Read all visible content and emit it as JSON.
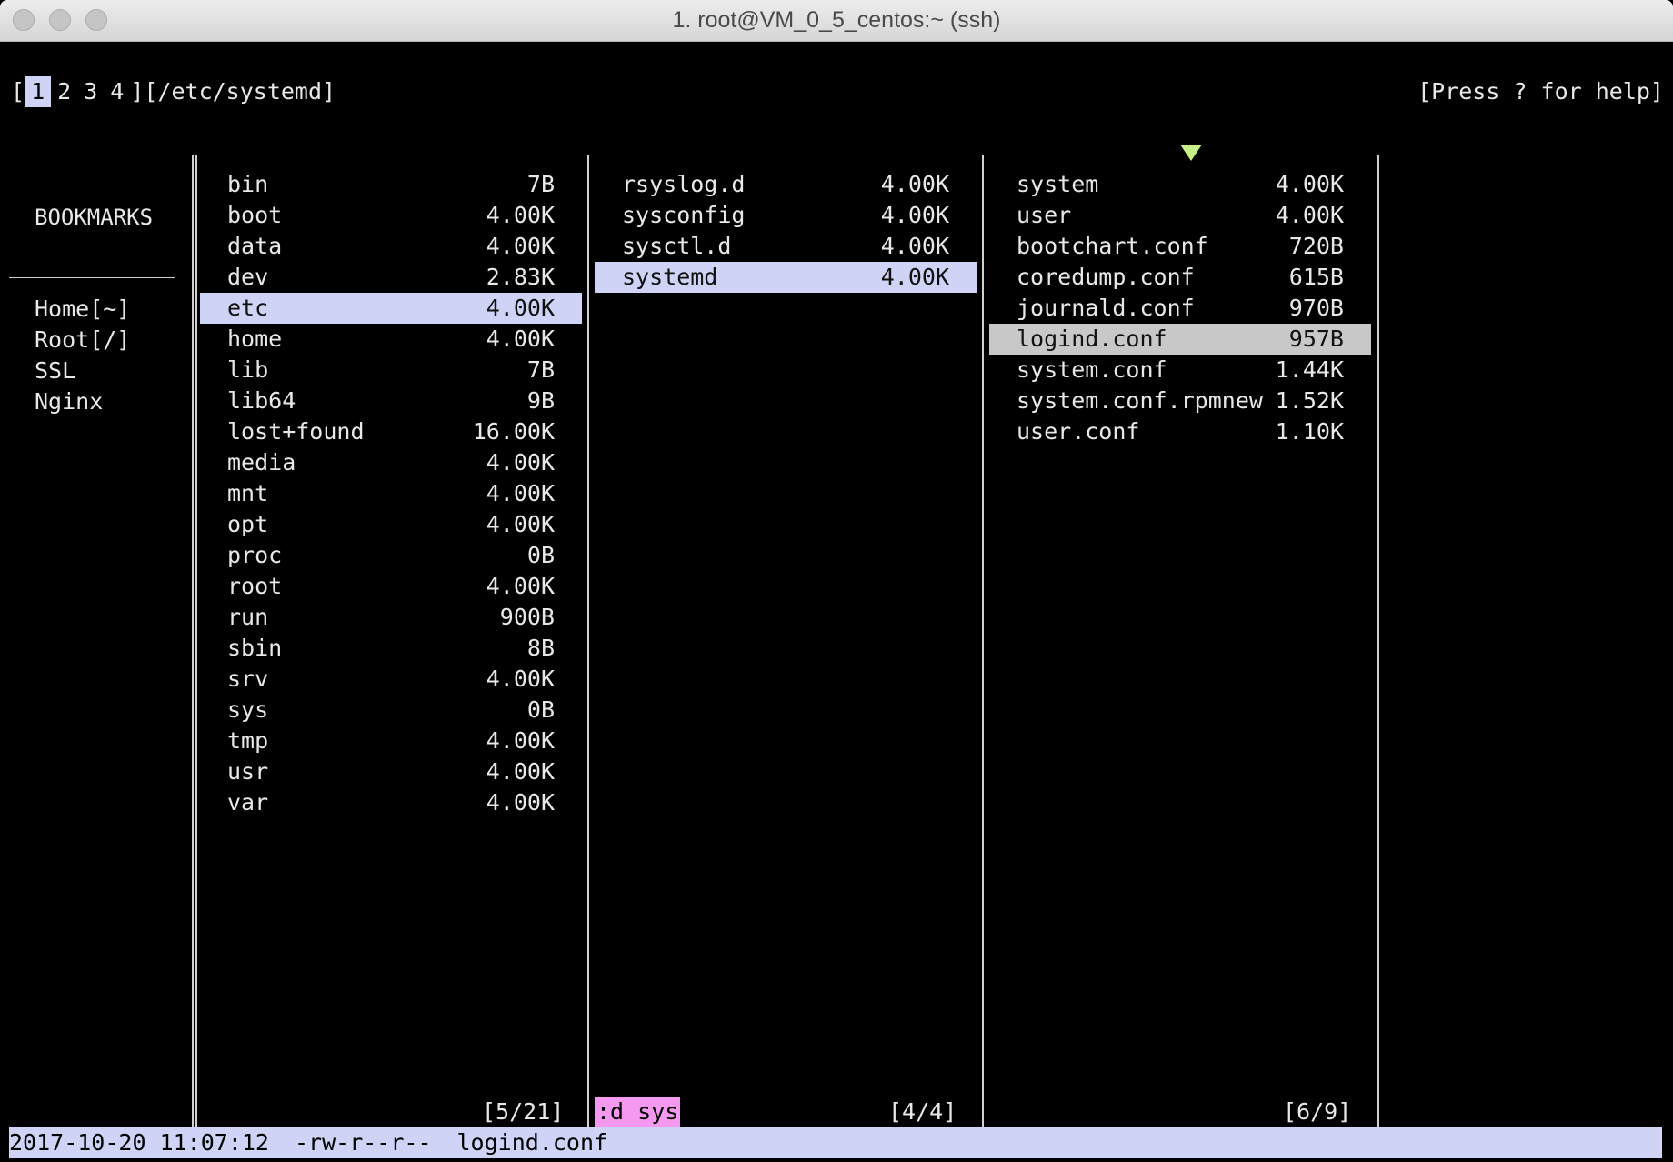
{
  "window": {
    "title": "1. root@VM_0_5_centos:~ (ssh)"
  },
  "header": {
    "bracket_open": "[",
    "tabs": [
      "1",
      "2",
      "3",
      "4"
    ],
    "path": "][/etc/systemd]",
    "help": "[Press ? for help]"
  },
  "bookmarks": {
    "title": "BOOKMARKS",
    "items": [
      "Home[~]",
      "Root[/]",
      "SSL",
      "Nginx"
    ]
  },
  "columns": {
    "root": {
      "rows": [
        {
          "name": "bin",
          "size": "7B"
        },
        {
          "name": "boot",
          "size": "4.00K"
        },
        {
          "name": "data",
          "size": "4.00K"
        },
        {
          "name": "dev",
          "size": "2.83K"
        },
        {
          "name": "etc",
          "size": "4.00K"
        },
        {
          "name": "home",
          "size": "4.00K"
        },
        {
          "name": "lib",
          "size": "7B"
        },
        {
          "name": "lib64",
          "size": "9B"
        },
        {
          "name": "lost+found",
          "size": "16.00K"
        },
        {
          "name": "media",
          "size": "4.00K"
        },
        {
          "name": "mnt",
          "size": "4.00K"
        },
        {
          "name": "opt",
          "size": "4.00K"
        },
        {
          "name": "proc",
          "size": "0B"
        },
        {
          "name": "root",
          "size": "4.00K"
        },
        {
          "name": "run",
          "size": "900B"
        },
        {
          "name": "sbin",
          "size": "8B"
        },
        {
          "name": "srv",
          "size": "4.00K"
        },
        {
          "name": "sys",
          "size": "0B"
        },
        {
          "name": "tmp",
          "size": "4.00K"
        },
        {
          "name": "usr",
          "size": "4.00K"
        },
        {
          "name": "var",
          "size": "4.00K"
        }
      ],
      "selected": 4,
      "counter": "[5/21]"
    },
    "etc": {
      "rows": [
        {
          "name": "rsyslog.d",
          "size": "4.00K"
        },
        {
          "name": "sysconfig",
          "size": "4.00K"
        },
        {
          "name": "sysctl.d",
          "size": "4.00K"
        },
        {
          "name": "systemd",
          "size": "4.00K"
        }
      ],
      "selected": 3,
      "counter": "[4/4]",
      "command": ":d sys"
    },
    "systemd": {
      "rows": [
        {
          "name": "system",
          "size": "4.00K"
        },
        {
          "name": "user",
          "size": "4.00K"
        },
        {
          "name": "bootchart.conf",
          "size": "720B"
        },
        {
          "name": "coredump.conf",
          "size": "615B"
        },
        {
          "name": "journald.conf",
          "size": "970B"
        },
        {
          "name": "logind.conf",
          "size": "957B"
        },
        {
          "name": "system.conf",
          "size": "1.44K"
        },
        {
          "name": "system.conf.rpmnew",
          "size": "1.52K"
        },
        {
          "name": "user.conf",
          "size": "1.10K"
        }
      ],
      "selected": 5,
      "counter": "[6/9]"
    }
  },
  "status": {
    "datetime": "2017-10-20 11:07:12",
    "permissions": "-rw-r--r--",
    "filename": "logind.conf"
  },
  "colors": {
    "selection": "#cfd3f5",
    "cursor": "#c8c8c8",
    "command": "#f598ef",
    "marker": "#c8f08a"
  }
}
